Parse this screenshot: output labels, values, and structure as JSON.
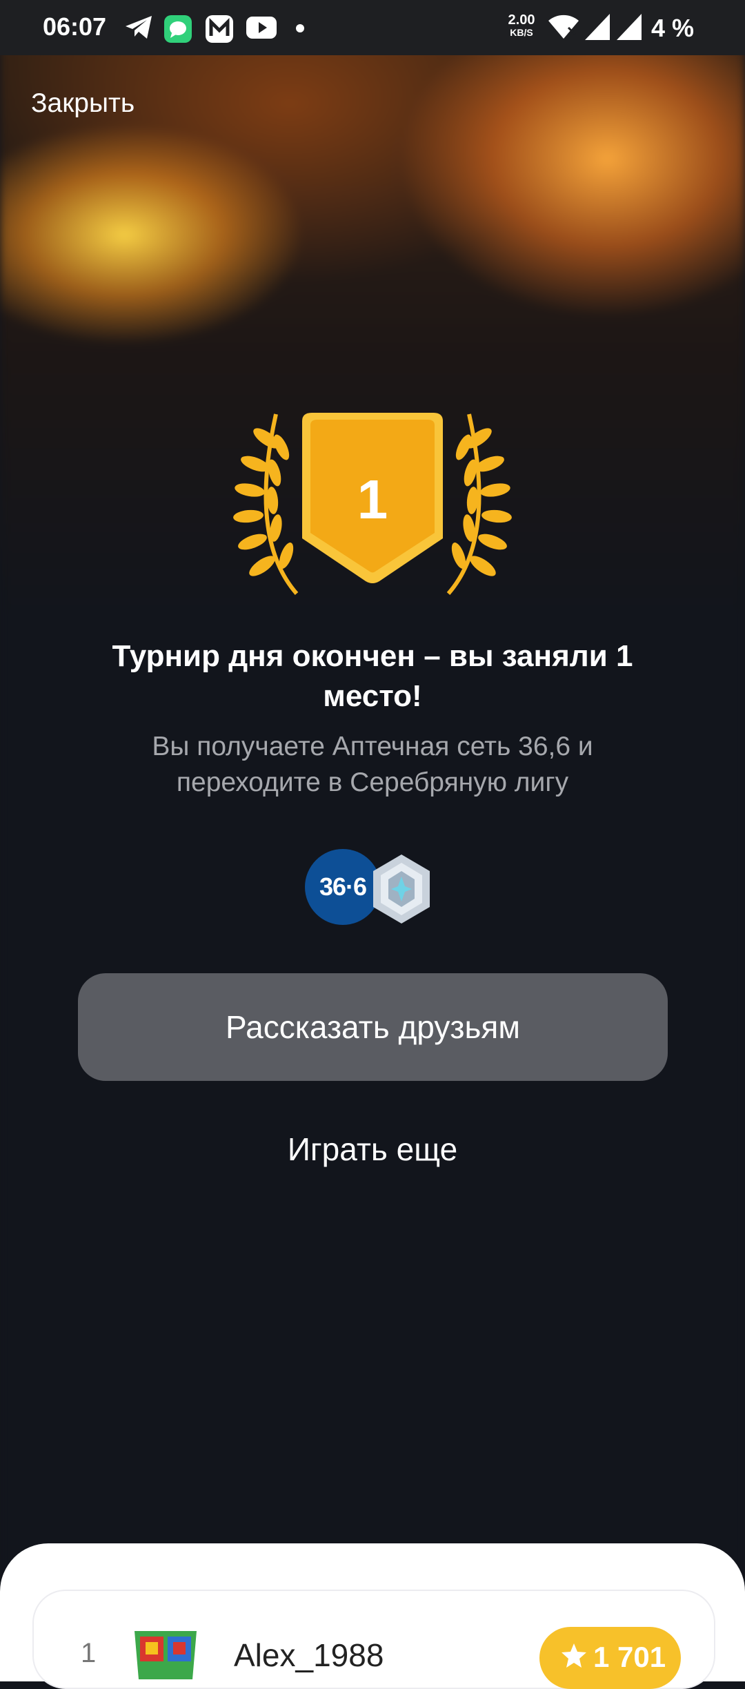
{
  "status_bar": {
    "time": "06:07",
    "network_speed_value": "2.00",
    "network_speed_unit": "KB/S",
    "battery": "4 %",
    "icons": [
      "telegram-icon",
      "messenger-icon",
      "m-app-icon",
      "youtube-icon",
      "dot-icon",
      "wifi-icon",
      "signal-icon",
      "signal-icon"
    ]
  },
  "header": {
    "close_label": "Закрыть"
  },
  "result": {
    "place": "1",
    "title": "Турнир дня окончен – вы заняли 1 место!",
    "subtitle": "Вы получаете Аптечная сеть 36,6 и переходите в Серебряную лигу",
    "prize_logo_text": "36·6"
  },
  "actions": {
    "share_label": "Рассказать друзьям",
    "play_again_label": "Играть еще"
  },
  "leaderboard": {
    "rows": [
      {
        "rank": "1",
        "name": "Alex_1988",
        "score": "1 701"
      }
    ]
  },
  "colors": {
    "background": "#12151c",
    "badge_gold": "#f6b41e",
    "button_gray": "#5a5c62",
    "score_yellow": "#f7c12a"
  }
}
